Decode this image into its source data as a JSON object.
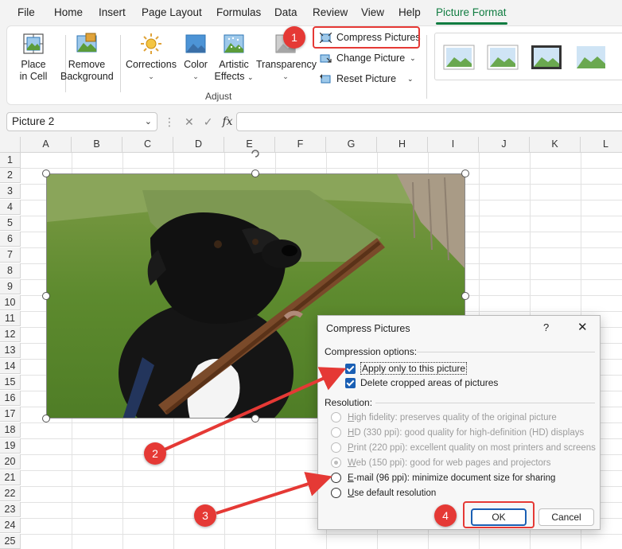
{
  "menu": {
    "items": [
      "File",
      "Home",
      "Insert",
      "Page Layout",
      "Formulas",
      "Data",
      "Review",
      "View",
      "Help",
      "Picture Format"
    ],
    "active": "Picture Format",
    "accent": "#107c41"
  },
  "ribbon": {
    "place_in_cell": [
      "Place",
      "in Cell"
    ],
    "remove_background": [
      "Remove",
      "Background"
    ],
    "corrections": "Corrections",
    "color": "Color",
    "artistic_effects": [
      "Artistic",
      "Effects"
    ],
    "transparency": "Transparency",
    "compress_pictures": "Compress Pictures",
    "change_picture": "Change Picture",
    "reset_picture": "Reset Picture",
    "adjust_group": "Adjust"
  },
  "formula_bar": {
    "name_box": "Picture 2",
    "fx": "fx"
  },
  "grid": {
    "columns": [
      "A",
      "B",
      "C",
      "D",
      "E",
      "F",
      "G",
      "H",
      "I",
      "J",
      "K",
      "L"
    ],
    "rows": [
      "1",
      "2",
      "3",
      "4",
      "5",
      "6",
      "7",
      "8",
      "9",
      "10",
      "11",
      "12",
      "13",
      "14",
      "15",
      "16",
      "17",
      "18",
      "19",
      "20",
      "21",
      "22",
      "23",
      "24",
      "25"
    ]
  },
  "dialog": {
    "title": "Compress Pictures",
    "help": "?",
    "close": "✕",
    "compression_label": "Compression options:",
    "apply_only": "Apply only to this picture",
    "delete_cropped": "Delete cropped areas of pictures",
    "resolution_label": "Resolution:",
    "options": [
      {
        "key": "H",
        "rest": "igh fidelity: preserves quality of the original picture",
        "disabled": true,
        "checked": false
      },
      {
        "key": "H",
        "rest": "D (330 ppi): good quality for high-definition (HD) displays",
        "disabled": true,
        "checked": false
      },
      {
        "key": "P",
        "rest": "rint (220 ppi): excellent quality on most printers and screens",
        "disabled": true,
        "checked": false
      },
      {
        "key": "W",
        "rest": "eb (150 ppi): good for web pages and projectors",
        "disabled": true,
        "checked": true
      },
      {
        "key": "E",
        "rest": "-mail (96 ppi): minimize document size for sharing",
        "disabled": false,
        "checked": false
      },
      {
        "key": "U",
        "rest": "se default resolution",
        "disabled": false,
        "checked": false
      }
    ],
    "ok": "OK",
    "cancel": "Cancel"
  },
  "annotations": {
    "badges": [
      "1",
      "2",
      "3",
      "4"
    ],
    "color": "#e53935"
  }
}
